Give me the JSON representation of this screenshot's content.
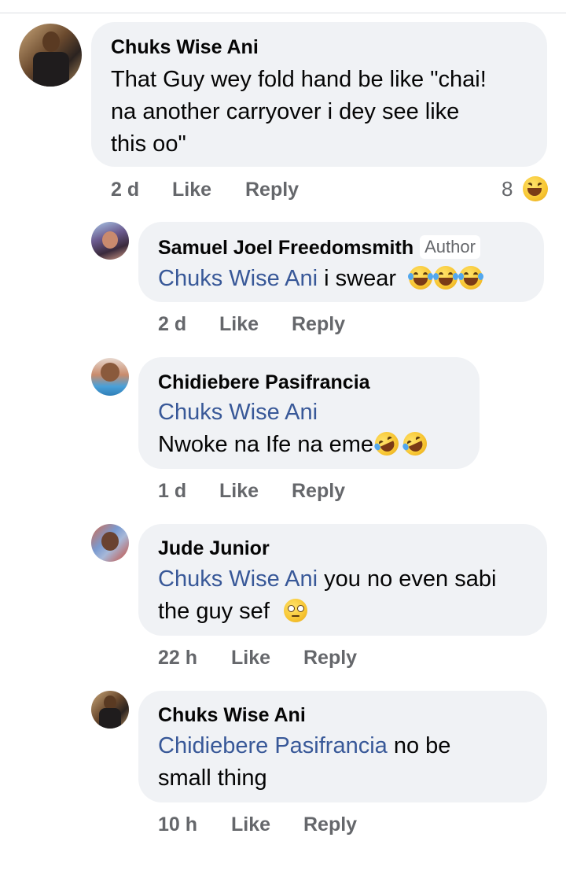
{
  "comments": [
    {
      "author": "Chuks Wise Ani",
      "badge": "",
      "mention": "",
      "text_lines": [
        "That Guy wey fold hand be like \"chai!",
        "na another carryover i dey see like",
        "this oo\""
      ],
      "time": "2 d",
      "like_label": "Like",
      "reply_label": "Reply",
      "reaction_count": "8",
      "reaction_icon": "laughing-emoji-icon"
    },
    {
      "author": "Samuel Joel Freedomsmith",
      "badge": "Author",
      "mention": "Chuks Wise Ani",
      "text": " i swear",
      "emojis": [
        "joy-emoji-icon",
        "joy-emoji-icon",
        "joy-emoji-icon"
      ],
      "time": "2 d",
      "like_label": "Like",
      "reply_label": "Reply"
    },
    {
      "author": "Chidiebere Pasifrancia",
      "badge": "",
      "mention": "Chuks Wise Ani",
      "text": "Nwoke na Ife na eme",
      "emojis": [
        "rofl-emoji-icon",
        "rofl-emoji-icon"
      ],
      "time": "1 d",
      "like_label": "Like",
      "reply_label": "Reply"
    },
    {
      "author": "Jude Junior",
      "badge": "",
      "mention": "Chuks Wise Ani",
      "text_after_mention": " you no even sabi",
      "text_line2": "the guy sef ",
      "emojis": [
        "eye-roll-emoji-icon"
      ],
      "time": "22 h",
      "like_label": "Like",
      "reply_label": "Reply"
    },
    {
      "author": "Chuks Wise Ani",
      "badge": "",
      "mention": "Chidiebere Pasifrancia",
      "text_after_mention": " no be",
      "text_line2": "small thing",
      "time": "10 h",
      "like_label": "Like",
      "reply_label": "Reply"
    }
  ],
  "colors": {
    "bubble": "#f0f2f5",
    "mention": "#385898",
    "meta": "#65676b",
    "text": "#050505"
  }
}
